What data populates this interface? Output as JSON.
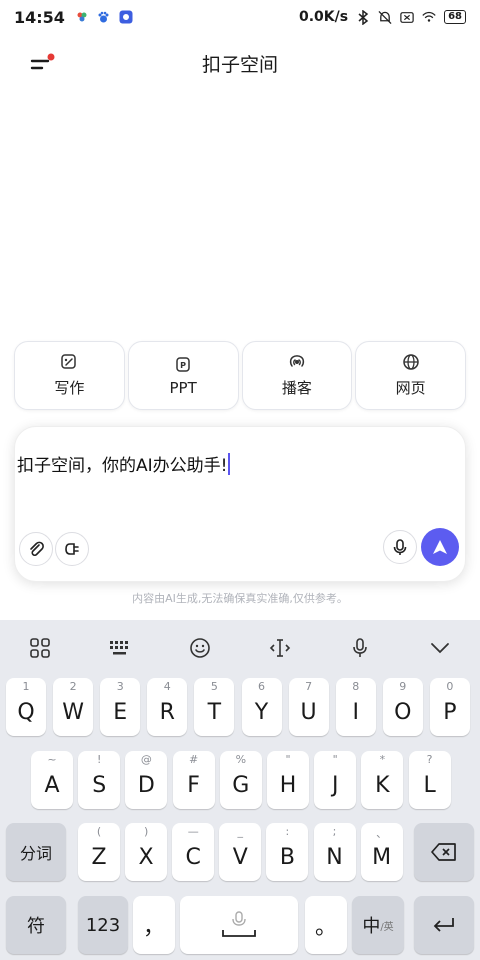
{
  "status": {
    "time": "14:54",
    "net_speed": "0.0K/s",
    "battery": "68"
  },
  "header": {
    "title": "扣子空间"
  },
  "tools": [
    {
      "label": "写作",
      "icon": "write-icon"
    },
    {
      "label": "PPT",
      "icon": "ppt-icon"
    },
    {
      "label": "播客",
      "icon": "podcast-icon"
    },
    {
      "label": "网页",
      "icon": "globe-icon"
    }
  ],
  "input": {
    "value": "扣子空间，你的AI办公助手!"
  },
  "disclaimer": "内容由AI生成,无法确保真实准确,仅供参考。",
  "keyboard": {
    "row1": [
      [
        "Q",
        "1"
      ],
      [
        "W",
        "2"
      ],
      [
        "E",
        "3"
      ],
      [
        "R",
        "4"
      ],
      [
        "T",
        "5"
      ],
      [
        "Y",
        "6"
      ],
      [
        "U",
        "7"
      ],
      [
        "I",
        "8"
      ],
      [
        "O",
        "9"
      ],
      [
        "P",
        "0"
      ]
    ],
    "row2": [
      [
        "A",
        "~"
      ],
      [
        "S",
        "!"
      ],
      [
        "D",
        "@"
      ],
      [
        "F",
        "#"
      ],
      [
        "G",
        "%"
      ],
      [
        "H",
        "\""
      ],
      [
        "J",
        "\""
      ],
      [
        "K",
        "*"
      ],
      [
        "L",
        "?"
      ]
    ],
    "row3": [
      [
        "Z",
        "("
      ],
      [
        "X",
        ")"
      ],
      [
        "C",
        "—"
      ],
      [
        "V",
        "_"
      ],
      [
        "B",
        ":"
      ],
      [
        "N",
        ";"
      ],
      [
        "M",
        "、"
      ]
    ],
    "fenci": "分词",
    "fu": "符",
    "num": "123",
    "comma": "，",
    "period": "。",
    "lang_main": "中",
    "lang_sub": "/英"
  }
}
